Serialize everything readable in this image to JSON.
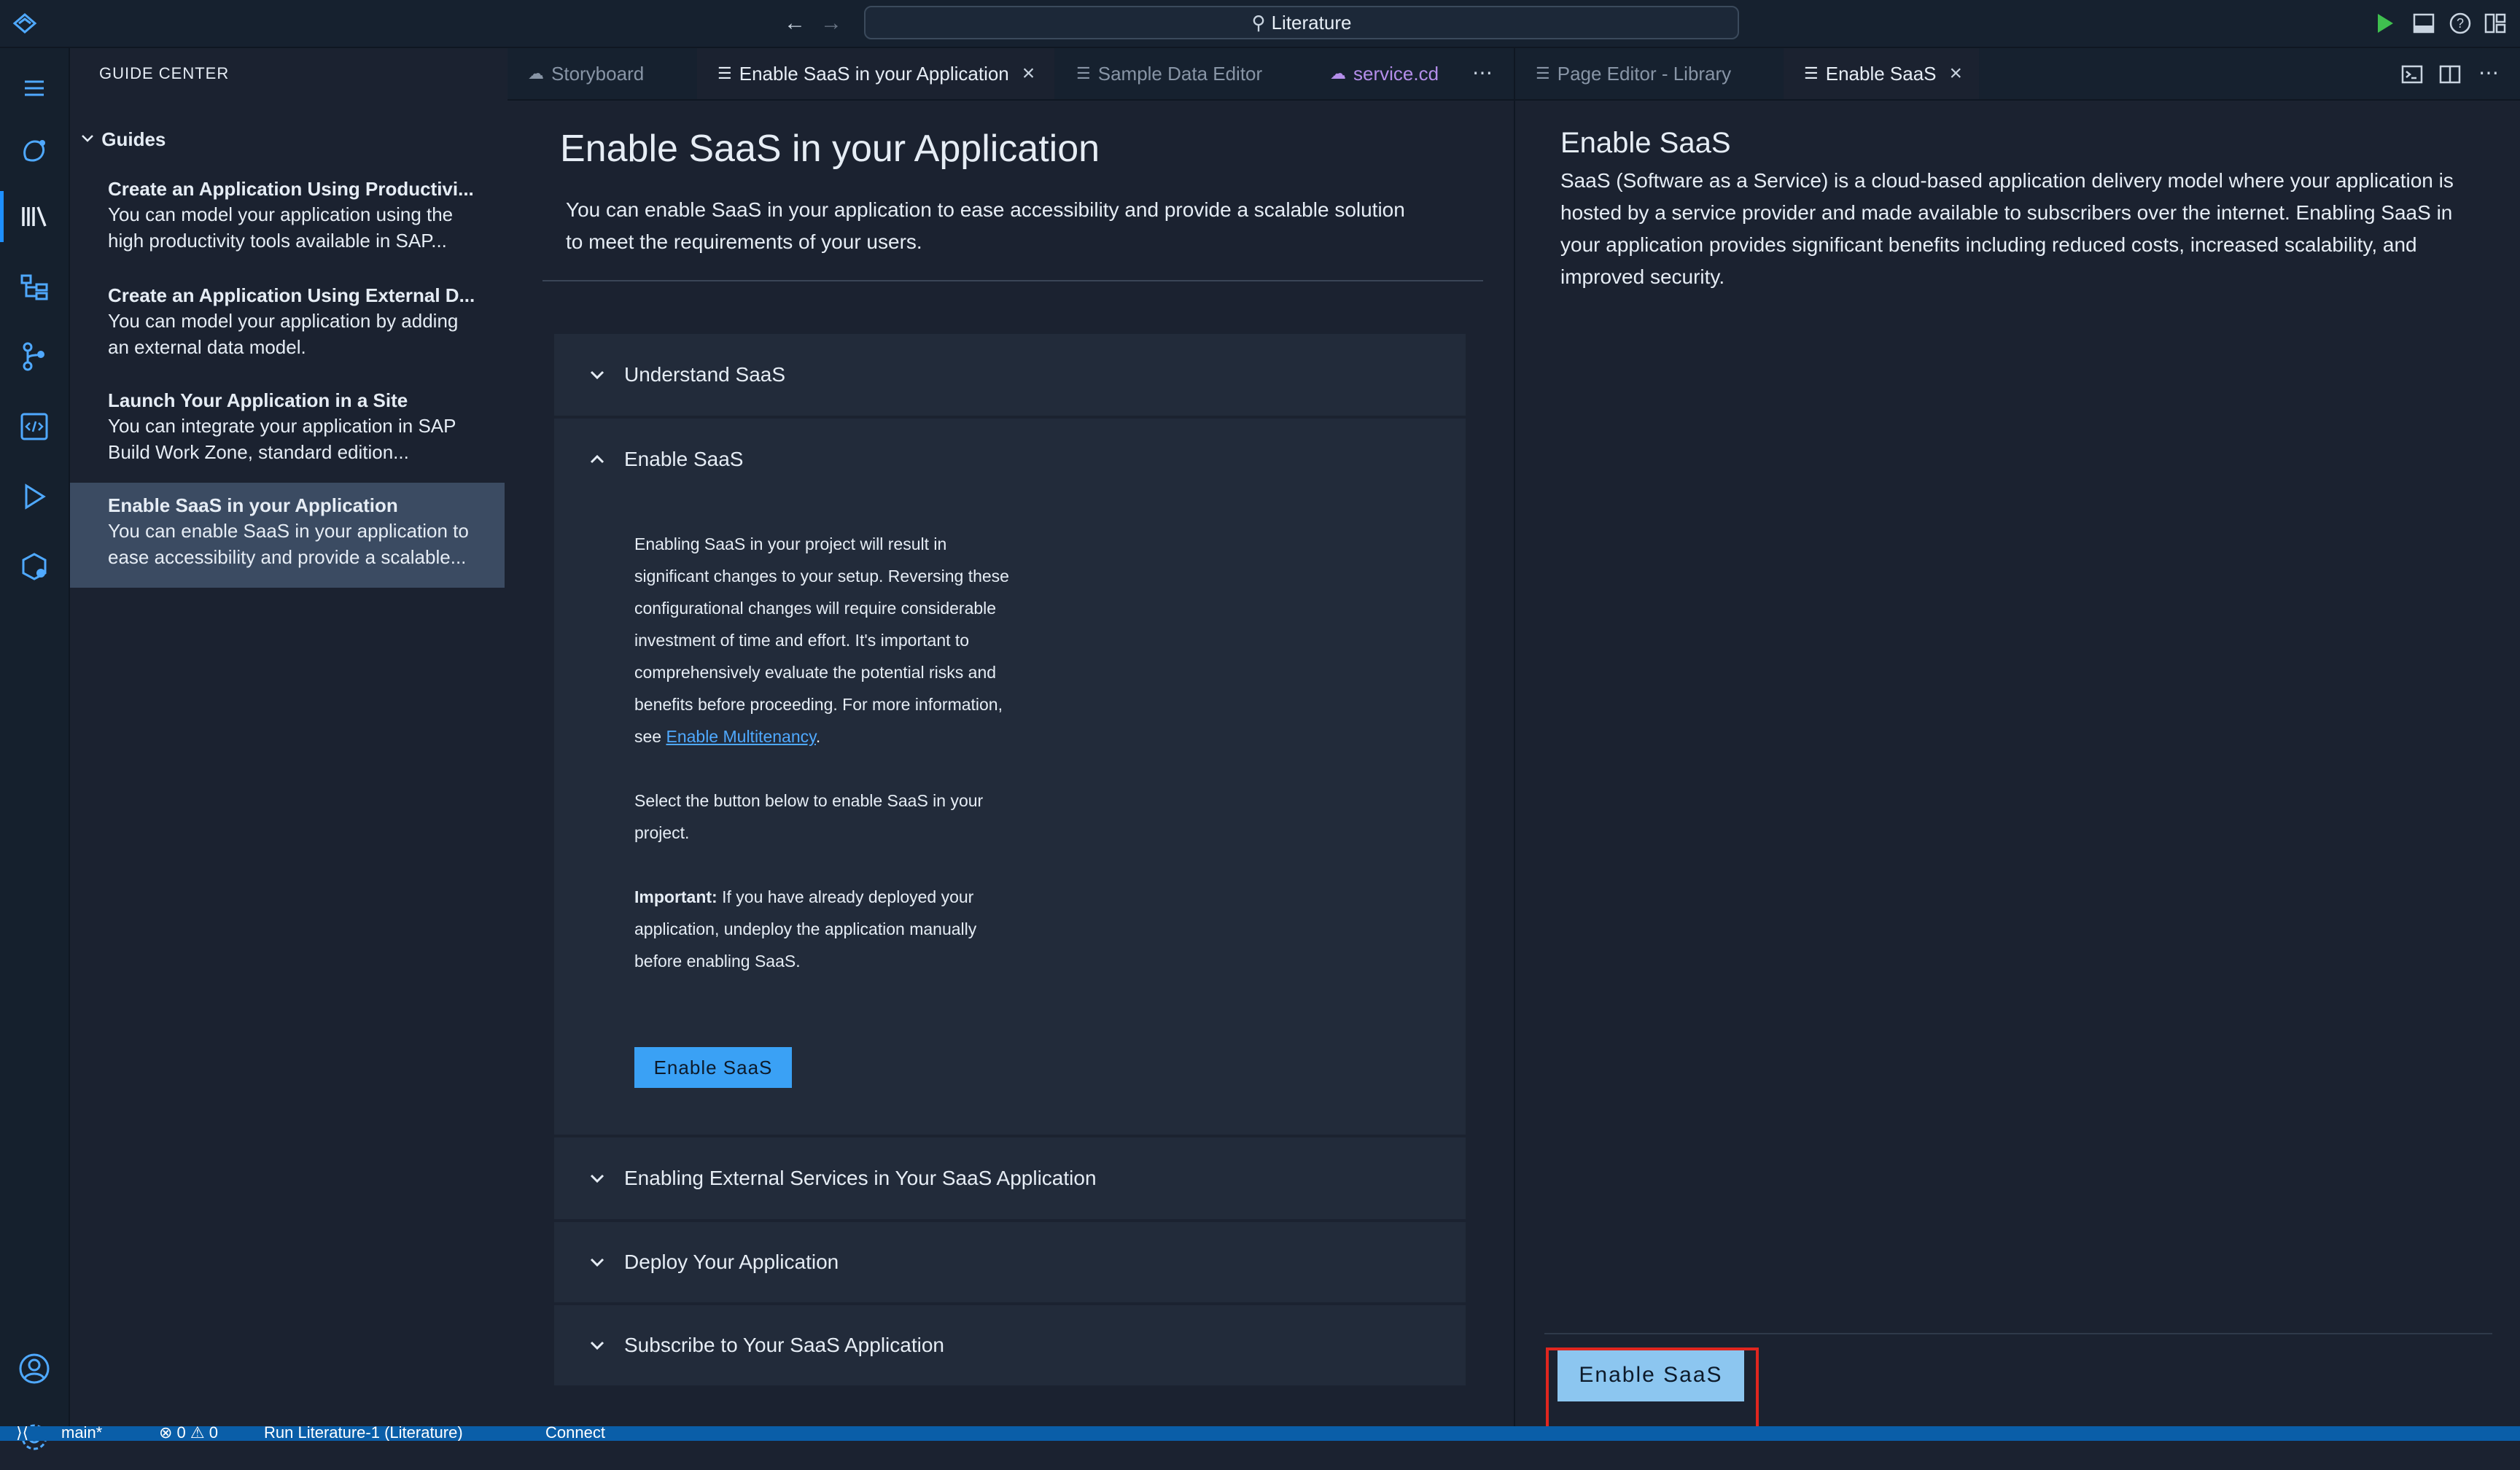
{
  "titlebar": {
    "search_text": "Literature",
    "nav_back": "←",
    "nav_forward": "→"
  },
  "sidebar": {
    "title": "GUIDE CENTER",
    "section": "Guides",
    "items": [
      {
        "title": "Create an Application Using Productivi...",
        "desc1": "You can model your application using the",
        "desc2": "high productivity tools available in SAP..."
      },
      {
        "title": "Create an Application Using External D...",
        "desc1": "You can model your application by adding",
        "desc2": "an external data model."
      },
      {
        "title": "Launch Your Application in a Site",
        "desc1": "You can integrate your application in SAP",
        "desc2": "Build Work Zone, standard edition..."
      },
      {
        "title": "Enable SaaS in your Application",
        "desc1": "You can enable SaaS in your application to",
        "desc2": "ease accessibility and provide a scalable..."
      }
    ]
  },
  "tabs_left": [
    {
      "label": "Storyboard"
    },
    {
      "label": "Enable SaaS in your Application"
    },
    {
      "label": "Sample Data Editor"
    },
    {
      "label": "service.cd"
    }
  ],
  "tabs_right": [
    {
      "label": "Page Editor - Library"
    },
    {
      "label": "Enable SaaS"
    }
  ],
  "left_page": {
    "title": "Enable SaaS in your Application",
    "subtitle_line1": "You can enable SaaS in your application to ease accessibility and provide a scalable solution",
    "subtitle_line2": "to meet the requirements of your users.",
    "sections": [
      {
        "label": "Understand SaaS"
      },
      {
        "label": "Enable SaaS"
      },
      {
        "label": "Enabling External Services in Your SaaS Application"
      },
      {
        "label": "Deploy Your Application"
      },
      {
        "label": "Subscribe to Your SaaS Application"
      }
    ],
    "body_para1": "Enabling SaaS in your project will result in significant changes to your setup. Reversing these configurational changes will require considerable investment of time and effort. It's important to comprehensively evaluate the potential risks and benefits before proceeding. For more information, see",
    "link_text": "Enable Multitenancy",
    "body_para2": "Select the button below to enable SaaS in your project.",
    "important_label": "Important:",
    "important_text": "If you have already deployed your application, undeploy the application manually before enabling SaaS.",
    "button_label": "Enable SaaS"
  },
  "right_page": {
    "title": "Enable SaaS",
    "text": "SaaS (Software as a Service) is a cloud-based application delivery model where your application is hosted by a service provider and made available to subscribers over the internet. Enabling SaaS in your application provides significant benefits including reduced costs, increased scalability, and improved security.",
    "button_label": "Enable SaaS"
  },
  "statusbar": {
    "branch": "main*",
    "problems": "⊗ 0 ⚠ 0",
    "run": "Run Literature-1 (Literature)",
    "connect": "Connect"
  },
  "colors": {
    "accent": "#3aa1f5",
    "highlight": "#e0261f",
    "statusbar": "#0a5ea8"
  }
}
